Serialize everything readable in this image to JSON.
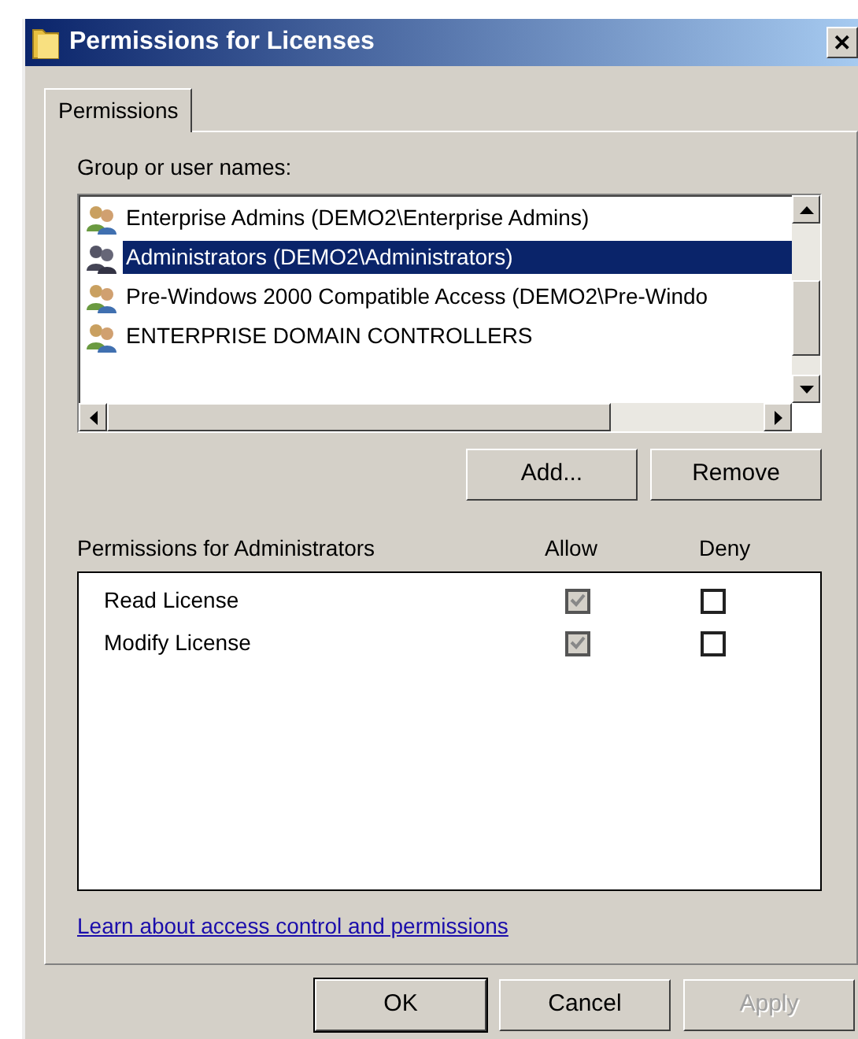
{
  "window": {
    "title": "Permissions for Licenses",
    "close": "✕"
  },
  "tabs": [
    {
      "label": "Permissions",
      "selected": true
    }
  ],
  "group_label": "Group or user names:",
  "users": [
    {
      "name": "Enterprise Admins (DEMO2\\Enterprise Admins)",
      "selected": false
    },
    {
      "name": "Administrators (DEMO2\\Administrators)",
      "selected": true
    },
    {
      "name": "Pre-Windows 2000 Compatible Access (DEMO2\\Pre-Windo",
      "selected": false
    },
    {
      "name": "ENTERPRISE DOMAIN CONTROLLERS",
      "selected": false
    }
  ],
  "user_buttons": [
    {
      "label": "Add..."
    },
    {
      "label": "Remove"
    }
  ],
  "permissions": {
    "title": "Permissions for Administrators",
    "allow_header": "Allow",
    "deny_header": "Deny",
    "rows": [
      {
        "name": "Read License",
        "allow": {
          "checked": true,
          "disabled": true
        },
        "deny": {
          "checked": false,
          "disabled": false
        }
      },
      {
        "name": "Modify License",
        "allow": {
          "checked": true,
          "disabled": true
        },
        "deny": {
          "checked": false,
          "disabled": false
        }
      }
    ]
  },
  "link": "Learn about access control and permissions",
  "buttons": [
    {
      "label": "OK",
      "default": true,
      "disabled": false
    },
    {
      "label": "Cancel",
      "default": false,
      "disabled": false
    },
    {
      "label": "Apply",
      "default": false,
      "disabled": true
    }
  ]
}
